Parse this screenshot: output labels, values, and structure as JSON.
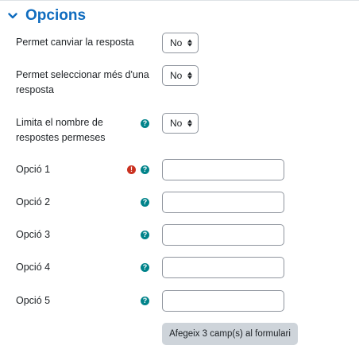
{
  "section": {
    "title": "Opcions",
    "icon": "chevron-down-icon"
  },
  "fields": {
    "allow_update": {
      "label": "Permet canviar la resposta",
      "value": "No"
    },
    "allow_multiple": {
      "label": "Permet seleccionar més d'una resposta",
      "value": "No"
    },
    "limit_answers": {
      "label": "Limita el nombre de respostes permeses",
      "value": "No"
    },
    "options": [
      {
        "label": "Opció 1",
        "value": "",
        "required": true
      },
      {
        "label": "Opció 2",
        "value": ""
      },
      {
        "label": "Opció 3",
        "value": ""
      },
      {
        "label": "Opció 4",
        "value": ""
      },
      {
        "label": "Opció 5",
        "value": ""
      }
    ]
  },
  "add_button_label": "Afegeix 3 camp(s) al formulari",
  "colors": {
    "accent": "#0f6cbf",
    "help": "#00838a",
    "error": "#ca3120",
    "button_bg": "#ced4da"
  }
}
